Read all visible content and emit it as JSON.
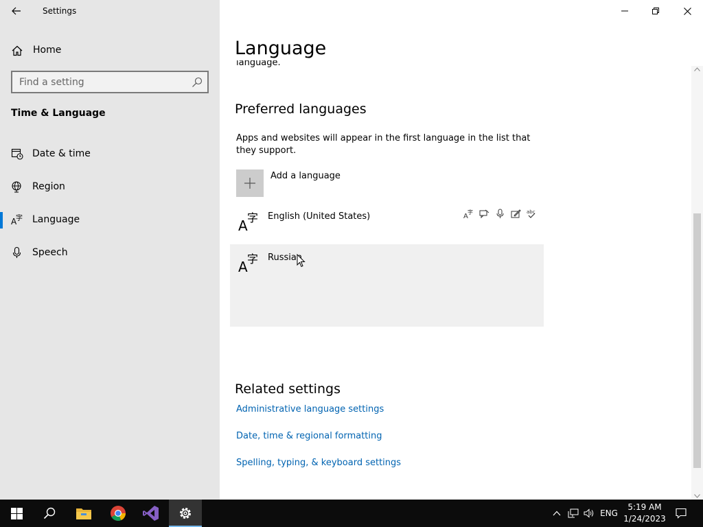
{
  "window": {
    "app_title": "Settings"
  },
  "sidebar": {
    "home_label": "Home",
    "search_placeholder": "Find a setting",
    "section_title": "Time & Language",
    "items": [
      {
        "label": "Date & time",
        "icon": "clock-calendar-icon",
        "active": false
      },
      {
        "label": "Region",
        "icon": "globe-icon",
        "active": false
      },
      {
        "label": "Language",
        "icon": "language-icon",
        "active": true
      },
      {
        "label": "Speech",
        "icon": "microphone-icon",
        "active": false
      }
    ]
  },
  "main": {
    "title": "Language",
    "clipped_text": "language.",
    "preferred": {
      "heading": "Preferred languages",
      "description": "Apps and websites will appear in the first language in the list that they support.",
      "add_label": "Add a language",
      "languages": [
        {
          "name": "English (United States)",
          "features": [
            "display-language-icon",
            "speech-recognition-icon",
            "text-to-speech-icon",
            "handwriting-icon",
            "spellcheck-icon"
          ]
        },
        {
          "name": "Russian",
          "selected": true
        }
      ]
    },
    "related": {
      "heading": "Related settings",
      "links": [
        "Administrative language settings",
        "Date, time & regional formatting",
        "Spelling, typing, & keyboard settings"
      ]
    }
  },
  "taskbar": {
    "apps": [
      "windows-start-icon",
      "search-icon",
      "file-explorer-icon",
      "chrome-icon",
      "visual-studio-icon",
      "settings-gear-icon"
    ],
    "active_app": "settings-gear-icon",
    "tray": {
      "input_language": "ENG",
      "time": "5:19 AM",
      "date": "1/24/2023"
    }
  },
  "colors": {
    "accent": "#0078d7",
    "link": "#0063b1",
    "sidebar_bg": "#e6e6e6",
    "taskbar_bg": "#0c0c0c"
  }
}
